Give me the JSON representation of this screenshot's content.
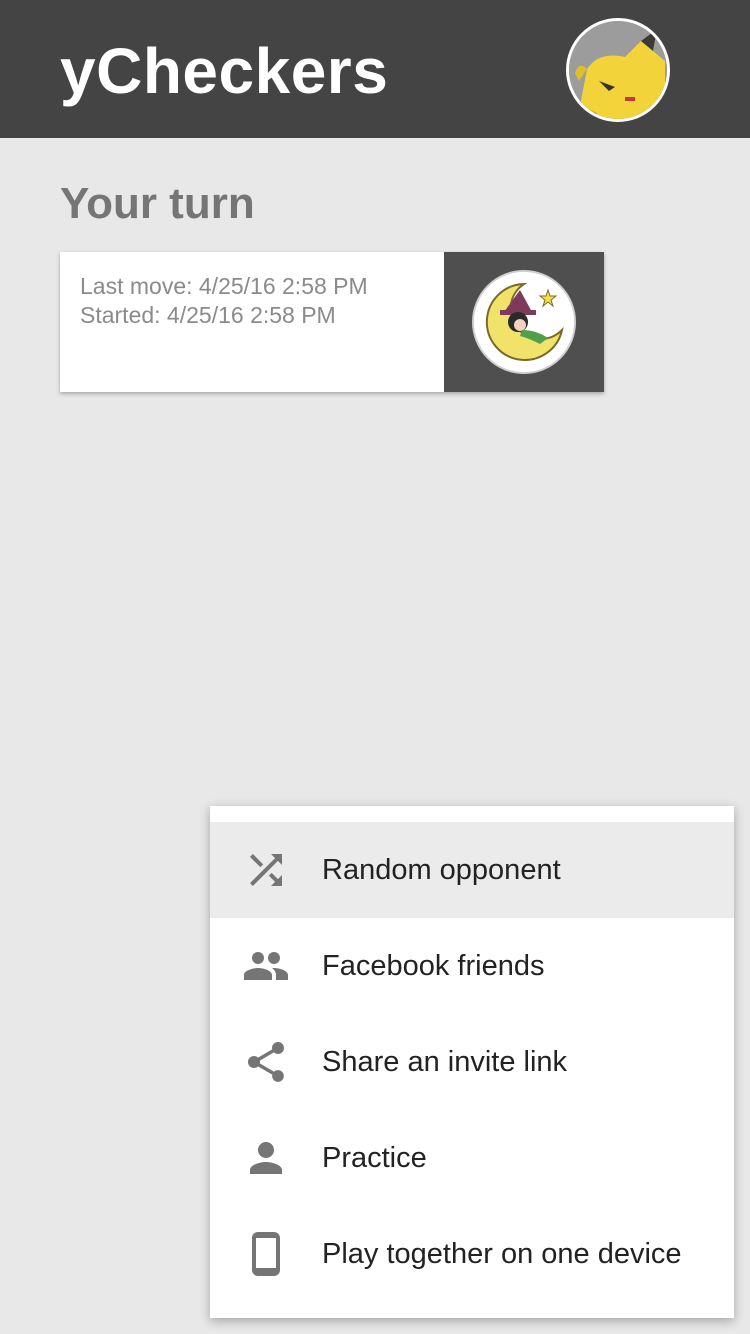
{
  "app_bar": {
    "title": "yCheckers",
    "profile_avatar": "pikachu-avatar"
  },
  "section": {
    "title": "Your turn"
  },
  "game_card": {
    "last_move": "Last move: 4/25/16 2:58 PM",
    "started": "Started: 4/25/16 2:58 PM",
    "opponent_avatar": "witch-on-moon-avatar"
  },
  "menu": {
    "items": [
      {
        "label": "Random opponent",
        "icon": "shuffle-icon",
        "highlighted": true
      },
      {
        "label": "Facebook friends",
        "icon": "people-icon",
        "highlighted": false
      },
      {
        "label": "Share an invite link",
        "icon": "share-icon",
        "highlighted": false
      },
      {
        "label": "Practice",
        "icon": "person-icon",
        "highlighted": false
      },
      {
        "label": "Play together on one device",
        "icon": "phone-icon",
        "highlighted": false
      }
    ]
  },
  "colors": {
    "app_bar": "#444444",
    "background": "#e8e8e8",
    "card_opponent_bg": "#4f4f4f",
    "menu_highlight": "#ebebeb",
    "icon": "#757575"
  }
}
